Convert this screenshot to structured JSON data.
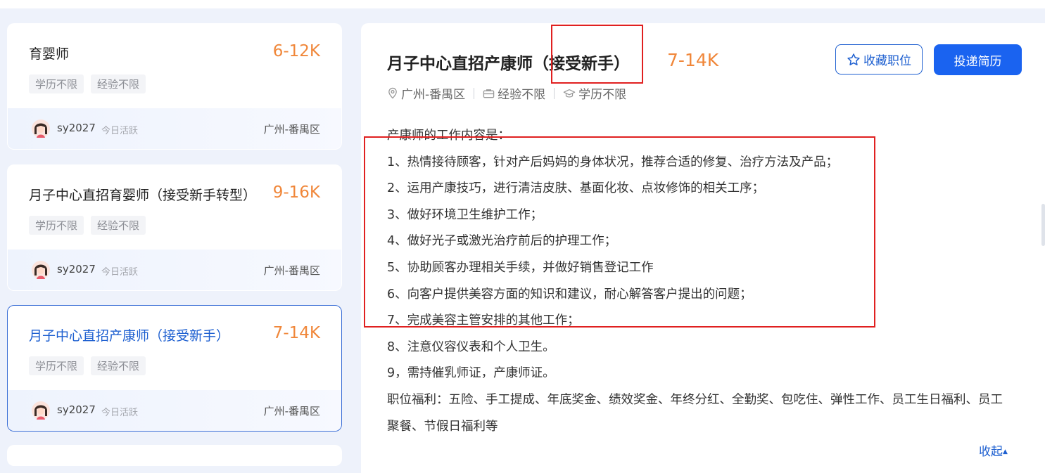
{
  "job_list": [
    {
      "title": "育婴师",
      "salary": "6-12K",
      "tags": [
        "学历不限",
        "经验不限"
      ],
      "hr_name": "sy2027",
      "hr_status": "今日活跃",
      "city": "广州-番禺区",
      "active": false
    },
    {
      "title": "月子中心直招育婴师（接受新手转型）",
      "salary": "9-16K",
      "tags": [
        "学历不限",
        "经验不限"
      ],
      "hr_name": "sy2027",
      "hr_status": "今日活跃",
      "city": "广州-番禺区",
      "active": false
    },
    {
      "title": "月子中心直招产康师（接受新手）",
      "salary": "7-14K",
      "tags": [
        "学历不限",
        "经验不限"
      ],
      "hr_name": "sy2027",
      "hr_status": "今日活跃",
      "city": "广州-番禺区",
      "active": true
    }
  ],
  "detail": {
    "title": "月子中心直招产康师（接受新手）",
    "salary": "7-14K",
    "fav_label": "收藏职位",
    "apply_label": "投递简历",
    "location": "广州-番禺区",
    "experience": "经验不限",
    "education": "学历不限",
    "description": [
      "产康师的工作内容是：",
      "1、热情接待顾客，针对产后妈妈的身体状况，推荐合适的修复、治疗方法及产品；",
      "2、运用产康技巧，进行清洁皮肤、基面化妆、点妆修饰的相关工序；",
      "3、做好环境卫生维护工作；",
      "4、做好光子或激光治疗前后的护理工作；",
      "5、协助顾客办理相关手续，并做好销售登记工作",
      "6、向客户提供美容方面的知识和建议，耐心解答客户提出的问题；",
      "7、完成美容主管安排的其他工作；",
      "8、注意仪容仪表和个人卫生。",
      "9，需持催乳师证，产康师证。",
      "职位福利：五险、手工提成、年底奖金、绩效奖金、年终分红、全勤奖、包吃住、弹性工作、员工生日福利、员工聚餐、节假日福利等"
    ],
    "collapse_label": "收起"
  },
  "colors": {
    "salary": "#f0873a",
    "primary": "#1a63f0",
    "active_title": "#1d5fd0",
    "annotation": "#e02020"
  }
}
